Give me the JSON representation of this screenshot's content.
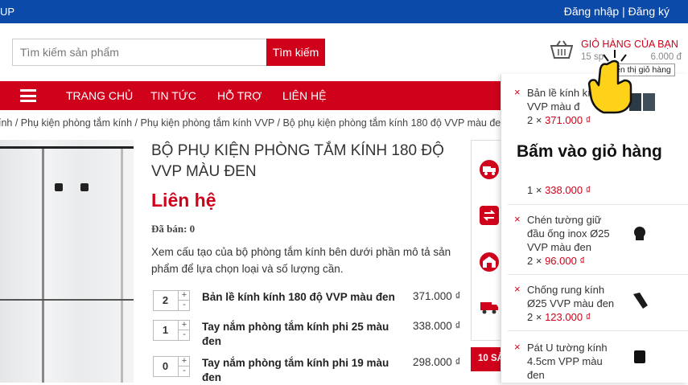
{
  "topbar": {
    "left_text": "UP",
    "login": "Đăng nhập",
    "separator": "|",
    "register": "Đăng ký"
  },
  "search": {
    "placeholder": "Tìm kiếm sản phẩm",
    "button": "Tìm kiếm"
  },
  "cart": {
    "title": "GIỎ HÀNG CỦA BẠN",
    "count_text": "15 sp",
    "total_text": "6.000 đ",
    "tooltip": "ển thị giỏ hàng",
    "icon": "cart-icon"
  },
  "nav": {
    "items": [
      "TRANG CHỦ",
      "TIN TỨC",
      "HỖ TRỢ",
      "LIÊN HỆ"
    ]
  },
  "breadcrumb": "ính / Phụ kiện phòng tắm kính / Phụ kiện phòng tắm kính VVP / Bộ phụ kiện phòng tắm kính 180 độ VVP màu đen",
  "product": {
    "title": "BỘ PHỤ KIỆN PHÒNG TẮM KÍNH 180 ĐỘ VVP MÀU ĐEN",
    "price_label": "Liên hệ",
    "sold": "Đã bán: 0",
    "description": "Xem cấu tạo của bộ phòng tắm kính bên dưới phần mô tả sản phẩm để lựa chọn loại và số lượng cần.",
    "options": [
      {
        "qty": "2",
        "name": "Bản lề kính kính 180 độ VVP màu đen",
        "price": "371.000 ₫"
      },
      {
        "qty": "1",
        "name": "Tay nắm phòng tắm kính phi 25 màu đen",
        "price": "338.000 ₫"
      },
      {
        "qty": "0",
        "name": "Tay nắm phòng tắm kính phi 19 màu đen",
        "price": "298.000 ₫"
      }
    ],
    "plus": "+",
    "minus": "-"
  },
  "side_tab": "10 SẢ",
  "cart_dropdown": {
    "remove": "×",
    "items": [
      {
        "name": "Bản lề kính kín độ VVP màu đ",
        "qty": "2 ×",
        "price": "371.000 ₫"
      },
      {
        "name": "",
        "qty": "1 ×",
        "price": "338.000 ₫"
      },
      {
        "name": "Chén tường giữ đầu ống inox Ø25 VVP màu đen",
        "qty": "2 ×",
        "price": "96.000 ₫"
      },
      {
        "name": "Chống rung kính Ø25 VVP màu đen",
        "qty": "2 ×",
        "price": "123.000 ₫"
      },
      {
        "name": "Pát U tường kính 4.5cm VPP màu đen",
        "qty": "",
        "price": ""
      }
    ]
  },
  "overlay": {
    "instruction": "Bấm vào giỏ hàng"
  },
  "colors": {
    "brand_red": "#d0021b",
    "topbar_blue": "#0b4aa8"
  }
}
